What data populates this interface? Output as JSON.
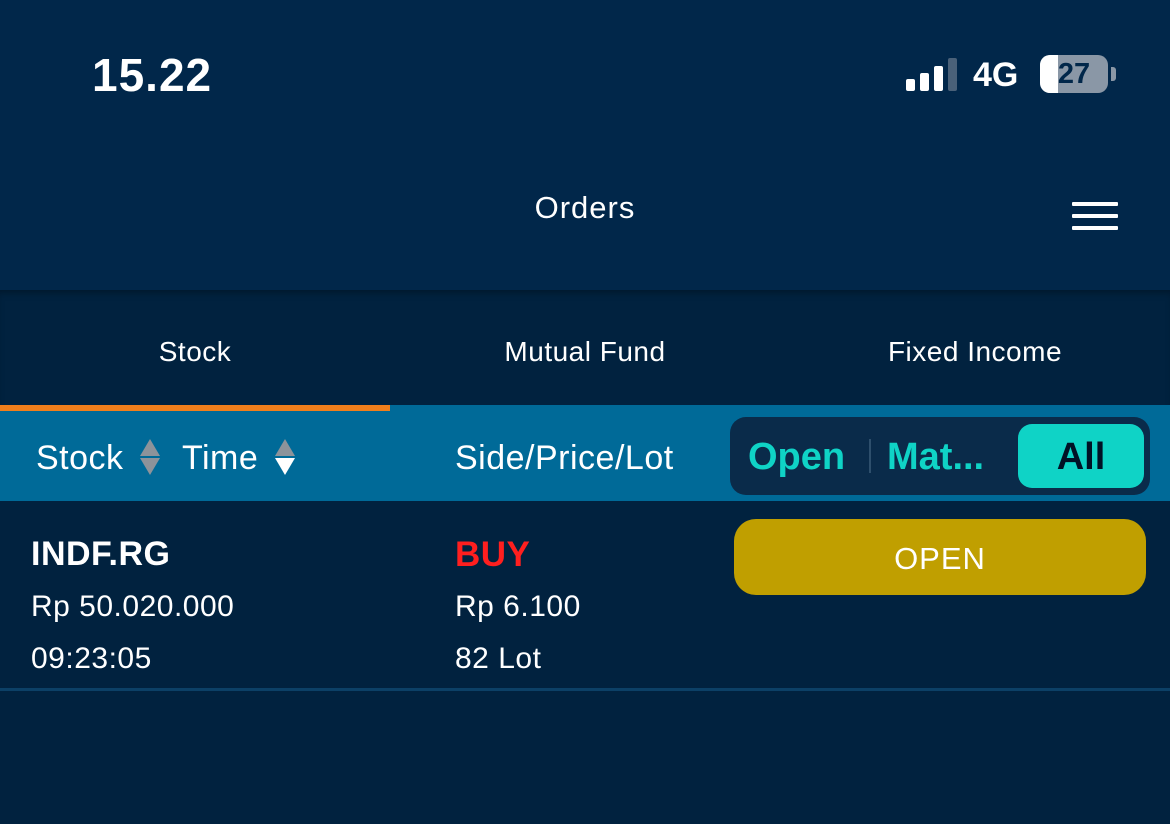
{
  "status_bar": {
    "time": "15.22",
    "network": "4G",
    "battery_percent": "27",
    "battery_level": 0.27,
    "signal_bars_active": 3,
    "icons": {
      "signal": "signal-bars-icon",
      "battery": "battery-icon"
    }
  },
  "header": {
    "title": "Orders",
    "menu_icon": "hamburger-menu-icon"
  },
  "tabs": {
    "items": [
      {
        "label": "Stock",
        "active": true
      },
      {
        "label": "Mutual Fund",
        "active": false
      },
      {
        "label": "Fixed Income",
        "active": false
      }
    ],
    "indicator_color": "#f07f1c"
  },
  "columns": {
    "stock": "Stock",
    "time": "Time",
    "side_price_lot": "Side/Price/Lot",
    "sort_icon": "sort-arrows-icon"
  },
  "filter": {
    "options": [
      "Open",
      "Mat...",
      "All"
    ],
    "selected": "All",
    "accent": "#0fd3c6"
  },
  "orders": [
    {
      "symbol": "INDF.RG",
      "amount": "Rp 50.020.000",
      "time": "09:23:05",
      "side": "BUY",
      "price": "Rp 6.100",
      "lot": "82 Lot",
      "status": "OPEN",
      "side_color": "#ff1f1f",
      "status_color": "#c09f00"
    }
  ]
}
